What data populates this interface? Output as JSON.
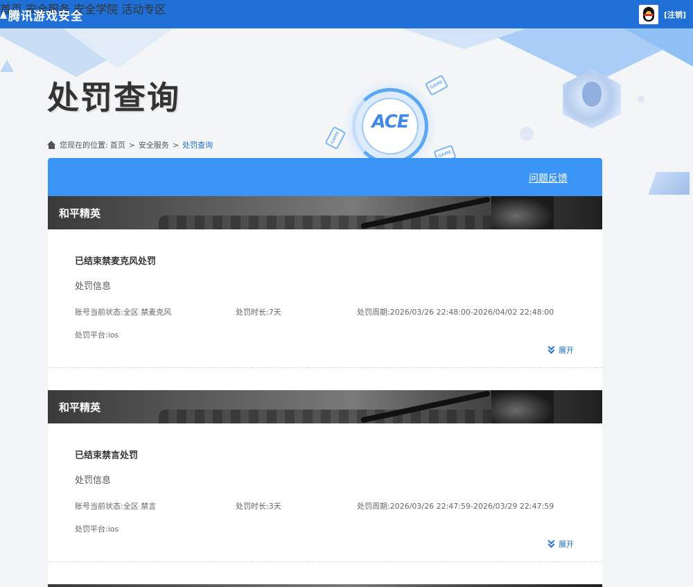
{
  "header": {
    "logo": "腾讯游戏安全",
    "nav": [
      "首页",
      "安全服务",
      "安全学院",
      "活动专区"
    ],
    "logout": "[注销]"
  },
  "hero": {
    "title": "处罚查询",
    "ace_logo": "ACE",
    "game_tags": [
      "GAME",
      "GAME",
      "GAME"
    ]
  },
  "breadcrumb": {
    "prefix": "您现在的位置:",
    "items": [
      "首页",
      "安全服务",
      "处罚查询"
    ]
  },
  "panel": {
    "feedback": "问题反馈"
  },
  "records": [
    {
      "game": "和平精英",
      "title": "已结束禁麦克风处罚",
      "subtitle": "处罚信息",
      "status": "账号当前状态:全区 禁麦克风",
      "duration": "处罚时长:7天",
      "period": "处罚周期:2026/03/26 22:48:00-2026/04/02 22:48:00",
      "platform": "处罚平台:ios",
      "expand": "展开"
    },
    {
      "game": "和平精英",
      "title": "已结束禁言处罚",
      "subtitle": "处罚信息",
      "status": "账号当前状态:全区 禁言",
      "duration": "处罚时长:3天",
      "period": "处罚周期:2026/03/26 22:47:59-2026/03/29 22:47:59",
      "platform": "处罚平台:ios",
      "expand": "展开"
    }
  ],
  "colors": {
    "topbar": "#1f6fd6",
    "panel_header": "#3994f6",
    "link": "#1f6fd6"
  }
}
